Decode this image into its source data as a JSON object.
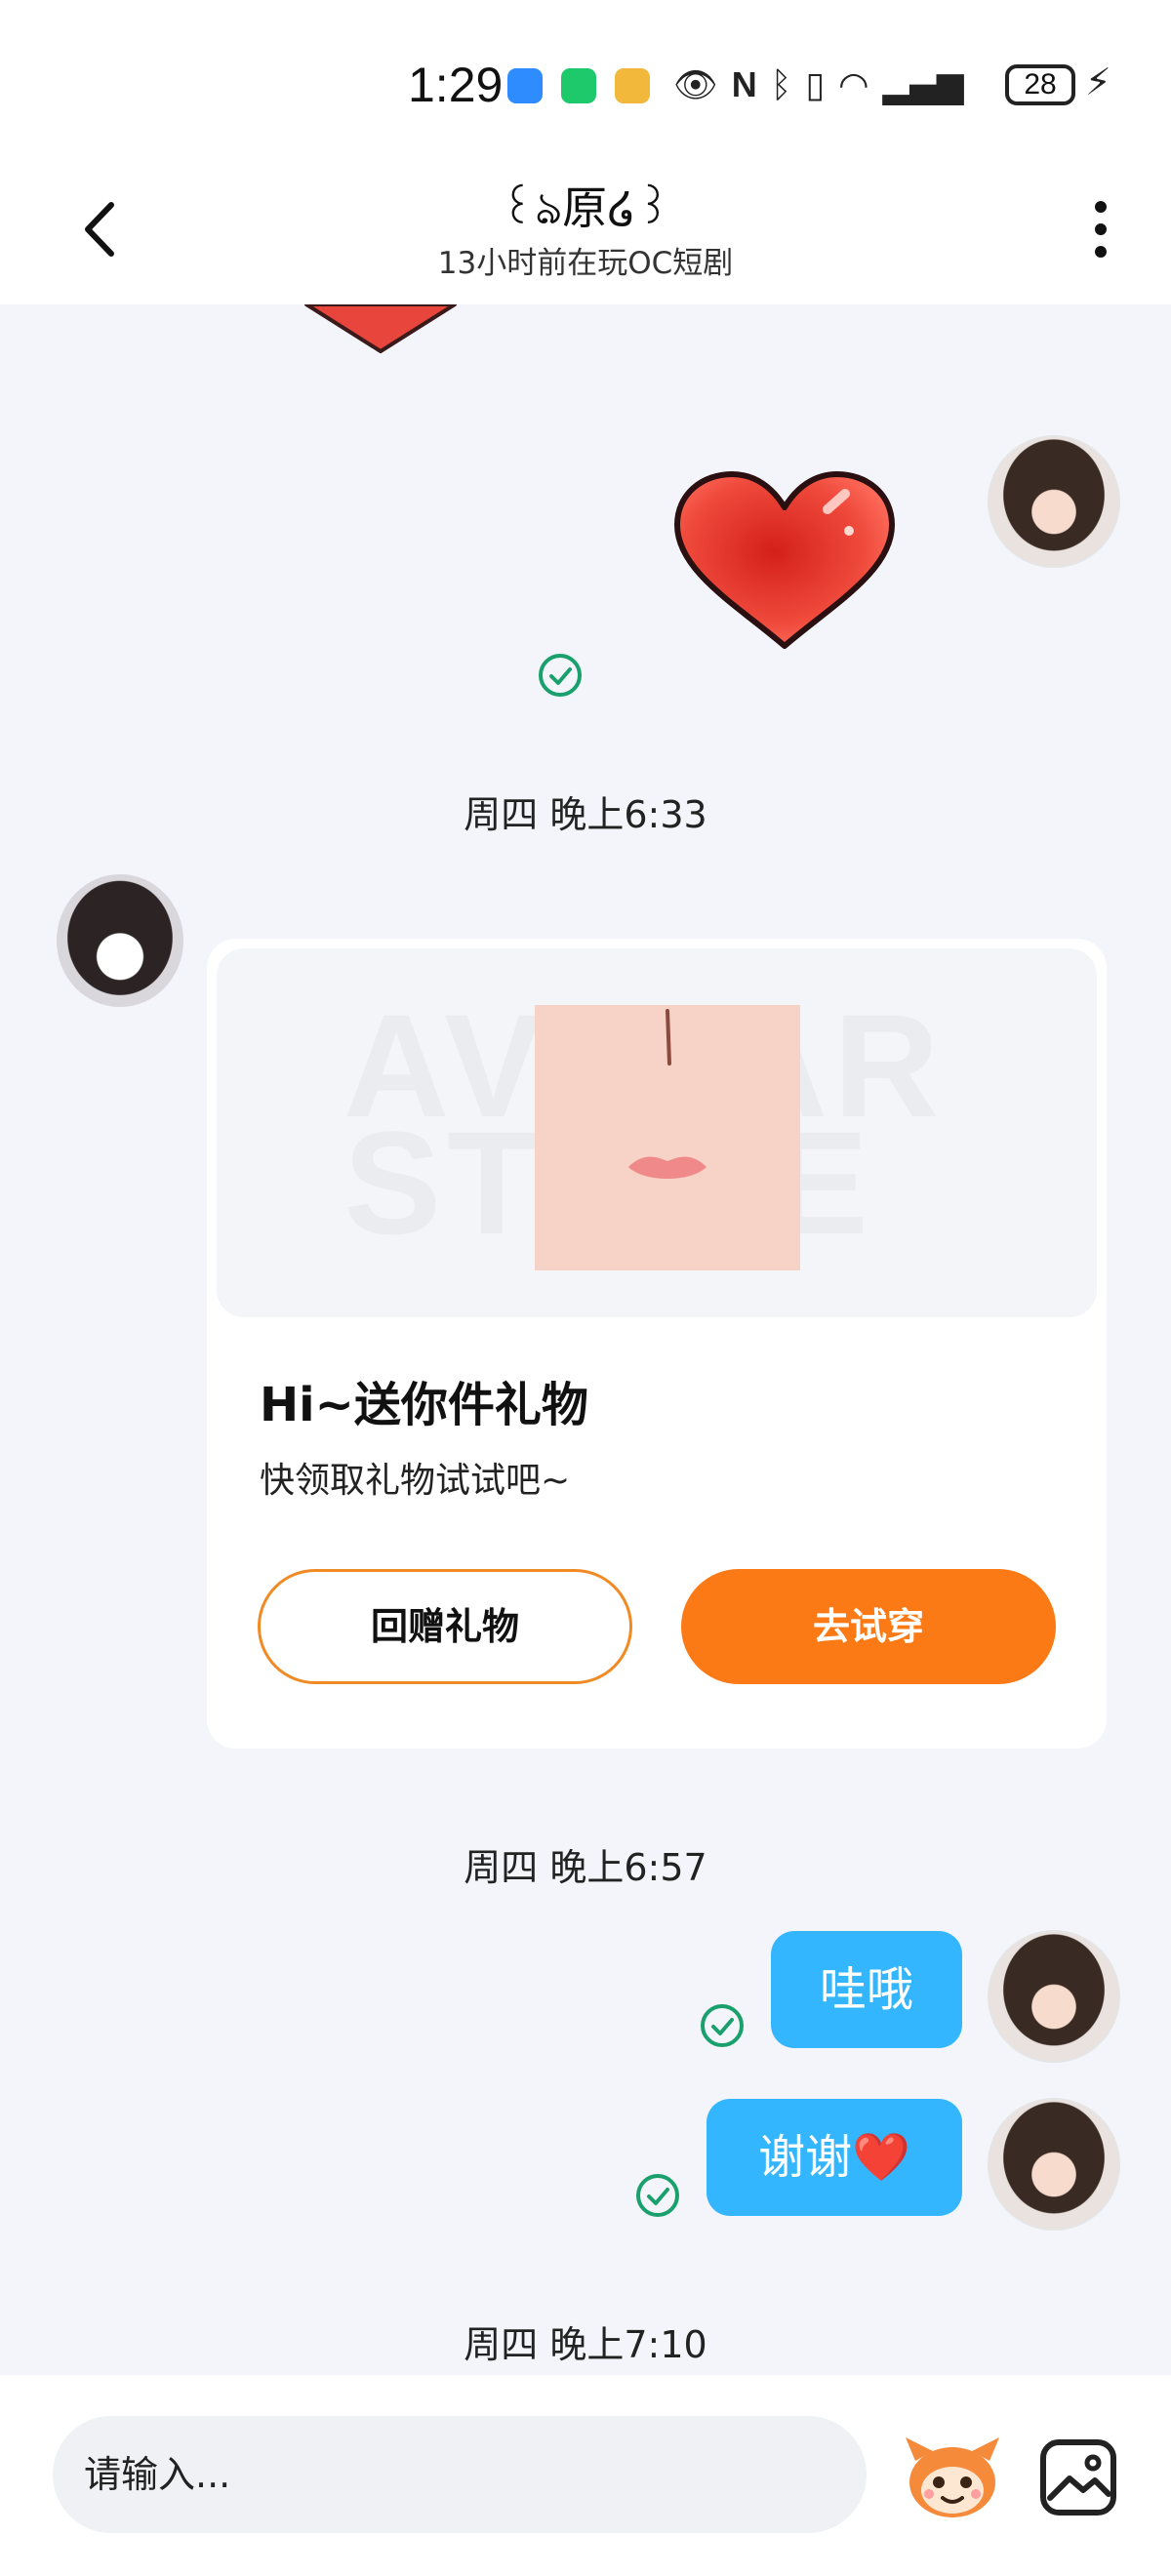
{
  "status_bar": {
    "time": "1:29",
    "battery": "28",
    "icons": [
      "cloud-app-icon",
      "phone-app-icon",
      "game-app-icon",
      "eye-icon",
      "nfc-icon",
      "bluetooth-icon",
      "vibrate-icon",
      "wifi-icon",
      "signal-icon",
      "charging-icon"
    ]
  },
  "header": {
    "contact_name": "꒰ঌ原໒꒱",
    "presence": "13小时前在玩OC短剧"
  },
  "messages": {
    "timestamp_1": "周四 晚上6:33",
    "timestamp_2": "周四 晚上6:57",
    "timestamp_3": "周四 晚上7:10",
    "bubble_1": "哇哦",
    "bubble_2": "谢谢❤️"
  },
  "gift_card": {
    "watermark": "AVATAR STORE",
    "title": "Hi~送你件礼物",
    "subtitle": "快领取礼物试试吧~",
    "return_gift_label": "回赠礼物",
    "try_on_label": "去试穿"
  },
  "composer": {
    "placeholder": "请输入..."
  },
  "colors": {
    "bubble_blue": "#34b6ff",
    "cta_orange": "#fb7a16",
    "check_green": "#1aa06d"
  }
}
